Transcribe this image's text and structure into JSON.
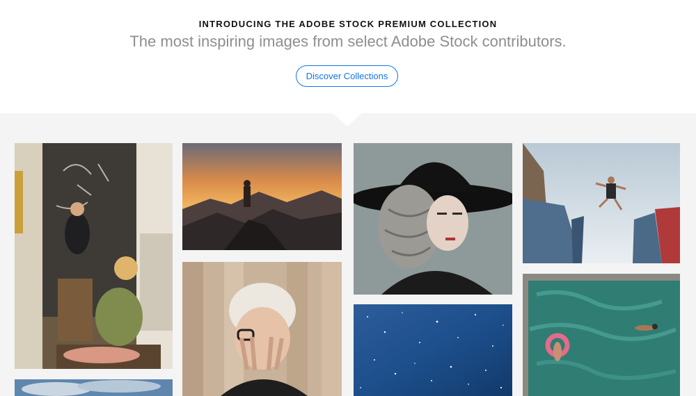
{
  "hero": {
    "eyebrow": "INTRODUCING THE ADOBE STOCK PREMIUM COLLECTION",
    "subtitle": "The most inspiring images from select Adobe Stock contributors.",
    "cta_label": "Discover Collections"
  },
  "gallery": {
    "tiles": [
      {
        "name": "photo-kitchen-chalkboard",
        "subject": "child on stool and woman in kitchen with chalkboard wall"
      },
      {
        "name": "photo-mountain-sunset",
        "subject": "hiker standing on mountain peak at sunset"
      },
      {
        "name": "photo-woman-black-hat",
        "subject": "woman in wide black hat and patterned headscarf"
      },
      {
        "name": "photo-man-jumping",
        "subject": "man leaping between shipping containers"
      },
      {
        "name": "photo-woman-covering-face",
        "subject": "woman covering face with hands against wooden wall"
      },
      {
        "name": "photo-starry-sky",
        "subject": "blue starry night sky"
      },
      {
        "name": "photo-pool-aerial",
        "subject": "aerial view of swimmers in turquoise pool"
      },
      {
        "name": "photo-cloudy-sky",
        "subject": "cloudy blue sky"
      }
    ]
  },
  "colors": {
    "accent": "#1473e6",
    "gallery_bg": "#f4f4f4",
    "subtitle": "#8e8e8e"
  }
}
